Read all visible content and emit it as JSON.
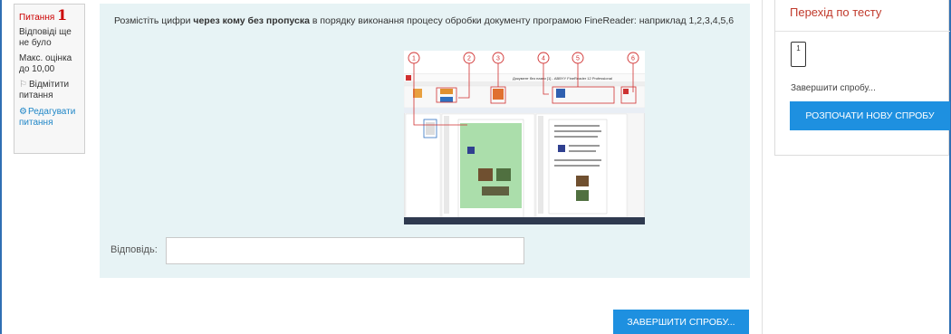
{
  "question_info": {
    "label": "Питання",
    "number": "1",
    "state": "Відповіді ще не було",
    "grade": "Макс. оцінка до 10,00",
    "flag_label": "Відмітити питання",
    "edit_label": "Редагувати питання"
  },
  "question": {
    "text_before": "Розмістіть цифри ",
    "text_bold": "через кому без пропуска",
    "text_after": " в порядку виконання процесу обробки документу програмою FineReader: наприклад 1,2,3,4,5,6",
    "image": {
      "window_title": "Документ без назви [1] - ABBYY FineReader 12 Professional",
      "markers": [
        "1",
        "2",
        "3",
        "4",
        "5",
        "6"
      ]
    },
    "answer_label": "Відповідь:",
    "answer_value": ""
  },
  "finish_button": "ЗАВЕРШИТИ СПРОБУ...",
  "nav": {
    "title": "Перехід по тесту",
    "question_buttons": [
      "1"
    ],
    "finish_link": "Завершити спробу...",
    "restart_button": "РОЗПОЧАТИ НОВУ СПРОБУ"
  },
  "colors": {
    "accent": "#1e90e0",
    "question_bg": "#e7f3f5",
    "title_red": "#c0392b",
    "marker_red": "#d03030"
  }
}
